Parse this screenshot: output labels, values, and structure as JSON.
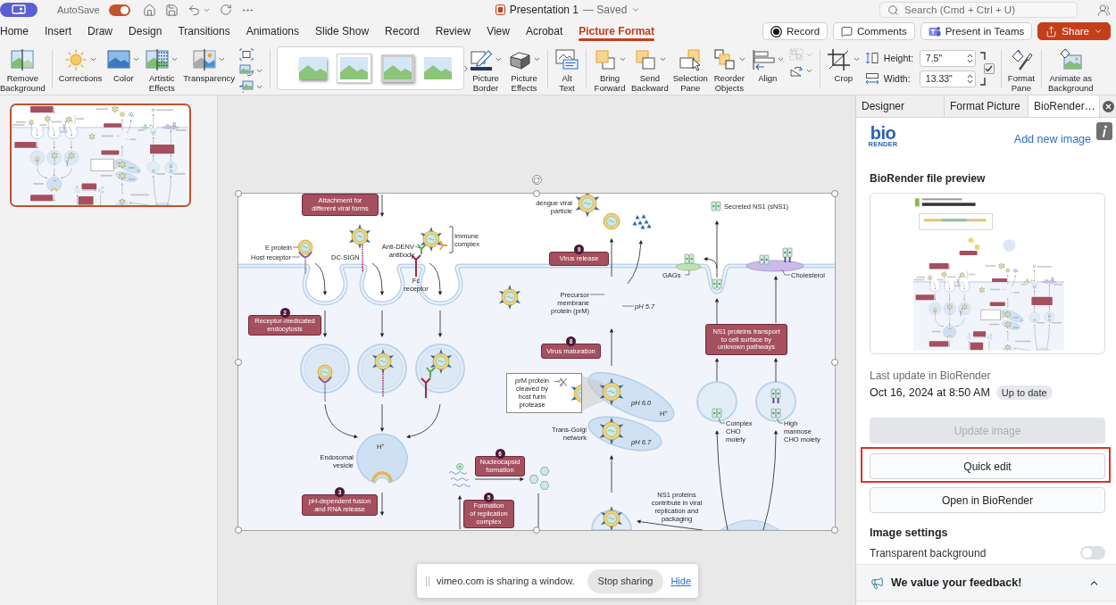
{
  "title_bar": {
    "autosave_label": "AutoSave",
    "autosave_on": true,
    "document_title": "Presentation 1",
    "save_status": "— Saved",
    "search_placeholder": "Search (Cmd + Ctrl + U)"
  },
  "menu_tabs": [
    {
      "label": "Home",
      "selected": false
    },
    {
      "label": "Insert",
      "selected": false
    },
    {
      "label": "Draw",
      "selected": false
    },
    {
      "label": "Design",
      "selected": false
    },
    {
      "label": "Transitions",
      "selected": false
    },
    {
      "label": "Animations",
      "selected": false
    },
    {
      "label": "Slide Show",
      "selected": false
    },
    {
      "label": "Record",
      "selected": false
    },
    {
      "label": "Review",
      "selected": false
    },
    {
      "label": "View",
      "selected": false
    },
    {
      "label": "Acrobat",
      "selected": false
    },
    {
      "label": "Picture Format",
      "selected": true
    }
  ],
  "header_buttons": [
    {
      "kind": "record",
      "label": "Record"
    },
    {
      "kind": "comments",
      "label": "Comments"
    },
    {
      "kind": "teams",
      "label": "Present in Teams"
    },
    {
      "kind": "share",
      "label": "Share"
    }
  ],
  "ribbon": {
    "groups": [
      [
        {
          "kind": "remove_background",
          "label": "Remove\nBackground",
          "dropdown": false
        }
      ],
      [
        {
          "kind": "corrections",
          "label": "Corrections",
          "dropdown": true
        },
        {
          "kind": "color",
          "label": "Color",
          "dropdown": true
        },
        {
          "kind": "artistic_effects",
          "label": "Artistic\nEffects",
          "dropdown": true
        },
        {
          "kind": "transparency",
          "label": "Transparency",
          "dropdown": true
        },
        {
          "kind": "tool_stack",
          "items": [
            {
              "kind": "compress",
              "dropdown": false,
              "disabled": false
            },
            {
              "kind": "change_picture",
              "dropdown": true,
              "disabled": false
            },
            {
              "kind": "reset_picture",
              "dropdown": true,
              "disabled": false
            }
          ]
        }
      ],
      [
        {
          "kind": "picture_styles"
        },
        {
          "kind": "picture_border",
          "label": "Picture\nBorder",
          "dropdown": true
        },
        {
          "kind": "picture_effects",
          "label": "Picture\nEffects",
          "dropdown": true
        }
      ],
      [
        {
          "kind": "alt_text",
          "label": "Alt\nText",
          "dropdown": false
        }
      ],
      [
        {
          "kind": "bring_forward",
          "label": "Bring\nForward",
          "dropdown": true
        },
        {
          "kind": "send_backward",
          "label": "Send\nBackward",
          "dropdown": true
        },
        {
          "kind": "selection_pane",
          "label": "Selection\nPane",
          "dropdown": false
        },
        {
          "kind": "reorder_objects",
          "label": "Reorder\nObjects",
          "dropdown": true
        },
        {
          "kind": "align",
          "label": "Align",
          "dropdown": true
        },
        {
          "kind": "tool_stack",
          "items": [
            {
              "kind": "group",
              "dropdown": true,
              "disabled": true
            },
            {
              "kind": "rotate",
              "dropdown": true,
              "disabled": false
            }
          ]
        }
      ],
      [
        {
          "kind": "crop",
          "label": "Crop",
          "dropdown": true
        },
        {
          "kind": "size",
          "fields": [
            {
              "kind": "height",
              "label": "Height:",
              "value": "7.5\""
            },
            {
              "kind": "width",
              "label": "Width:",
              "value": "13.33\""
            }
          ],
          "lock_aspect": true
        }
      ],
      [
        {
          "kind": "format_pane",
          "label": "Format\nPane",
          "dropdown": false
        }
      ],
      [
        {
          "kind": "animate_background",
          "label": "Animate as\nBackground",
          "dropdown": false
        }
      ]
    ]
  },
  "slides": [
    {
      "selected": true
    }
  ],
  "slide": {
    "selected": true,
    "labels": [
      {
        "kind": "step",
        "text": "Attachment for\ndifferent viral forms"
      },
      {
        "kind": "note",
        "text": "dengue viral\nparticle"
      },
      {
        "kind": "note",
        "text": "Secreted NS1 (sNS1)"
      },
      {
        "kind": "note",
        "text": "E protein"
      },
      {
        "kind": "note",
        "text": "Anti-DENV\nantibody"
      },
      {
        "kind": "note",
        "text": "Immune\ncomplex"
      },
      {
        "kind": "note",
        "text": "Host receptor"
      },
      {
        "kind": "note",
        "text": "DC-SIGN"
      },
      {
        "kind": "step",
        "text": "Virus release",
        "number": "9"
      },
      {
        "kind": "note",
        "text": "Fc\nreceptor"
      },
      {
        "kind": "note",
        "text": "GAGs"
      },
      {
        "kind": "note",
        "text": "Cholesterol"
      },
      {
        "kind": "note",
        "text": "Precursor\nmembrane\nprotein (prM)"
      },
      {
        "kind": "ph",
        "text": "pH 5.7"
      },
      {
        "kind": "step",
        "text": "Receptor-medicated\nendocytosis",
        "number": "2"
      },
      {
        "kind": "step",
        "text": "Virus maturation",
        "number": "8"
      },
      {
        "kind": "step",
        "text": "NS1 proteins transport\nto cell surface by\nunknown pathways"
      },
      {
        "kind": "callout",
        "text": "prM protein\ncleaved by\nhost furin\nprotease"
      },
      {
        "kind": "ph",
        "text": "pH 6.0"
      },
      {
        "kind": "note",
        "text": "H$^{+}$"
      },
      {
        "kind": "note",
        "text": "H$^{+}$"
      },
      {
        "kind": "note",
        "text": "Trans-Golgi\nnetwork"
      },
      {
        "kind": "ph",
        "text": "pH 6.7"
      },
      {
        "kind": "note",
        "text": "Complex\nCHO\nmoiety"
      },
      {
        "kind": "note",
        "text": "High\nmannose\nCHO moiety"
      },
      {
        "kind": "note",
        "text": "Endosomal\nvesicle"
      },
      {
        "kind": "step",
        "text": "Nucleocapsid\nformation",
        "number": "6"
      },
      {
        "kind": "step",
        "text": "pH-dependent fusion\nand RNA release",
        "number": "3"
      },
      {
        "kind": "step",
        "text": "Formation\nof replication\ncomplex",
        "number": "5"
      },
      {
        "kind": "note",
        "text": "NS1 proteins\ncontribute in viral\nreplication and\npackaging"
      }
    ]
  },
  "side_panel": {
    "tabs": [
      {
        "label": "Designer",
        "selected": false
      },
      {
        "label": "Format Picture",
        "selected": false
      },
      {
        "label": "BioRender…",
        "selected": true
      }
    ],
    "logo": {
      "wordmark": "bio",
      "subtitle": "RENDER"
    },
    "add_link": "Add new image",
    "preview_title": "BioRender file preview",
    "last_update_label": "Last update in BioRender",
    "last_update": "Oct 16, 2024 at 8:50 AM",
    "status_badge": "Up to date",
    "buttons": [
      {
        "label": "Update image",
        "disabled": true,
        "highlighted": false
      },
      {
        "label": "Quick edit",
        "disabled": false,
        "highlighted": true
      },
      {
        "label": "Open in BioRender",
        "disabled": false,
        "highlighted": false
      }
    ],
    "settings_title": "Image settings",
    "settings": [
      {
        "label": "Transparent background",
        "on": false
      }
    ],
    "feedback": {
      "label": "We value your feedback!",
      "expanded": false
    }
  },
  "sharing_bar": {
    "message": "vimeo.com is sharing a window.",
    "stop_button": "Stop sharing",
    "hide_link": "Hide"
  }
}
